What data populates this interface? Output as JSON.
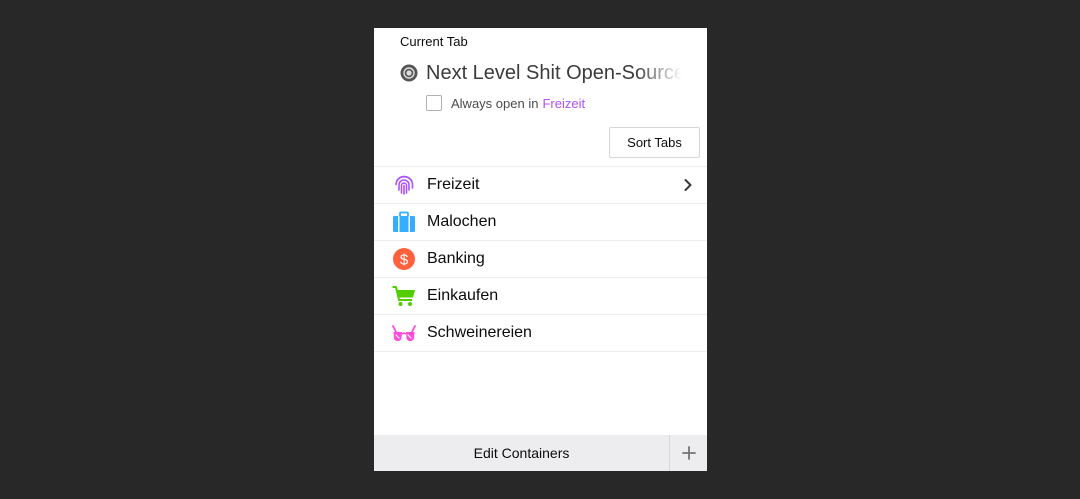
{
  "current_tab": {
    "section_label": "Current Tab",
    "title": "Next Level Shit Open-Source",
    "favicon": "record-icon",
    "always_open_prefix": "Always open in",
    "always_open_container": "Freizeit",
    "always_open_checked": false
  },
  "sort_tabs_label": "Sort Tabs",
  "containers": [
    {
      "name": "Freizeit",
      "icon": "fingerprint-icon",
      "color": "#af51f5",
      "has_submenu": true
    },
    {
      "name": "Malochen",
      "icon": "briefcase-icon",
      "color": "#37adff",
      "has_submenu": false
    },
    {
      "name": "Banking",
      "icon": "dollar-icon",
      "color": "#ff613d",
      "has_submenu": false
    },
    {
      "name": "Einkaufen",
      "icon": "cart-icon",
      "color": "#51cd00",
      "has_submenu": false
    },
    {
      "name": "Schweinereien",
      "icon": "glasses-icon",
      "color": "#ff4bda",
      "has_submenu": false
    }
  ],
  "footer": {
    "edit_label": "Edit Containers",
    "add_icon": "plus-icon"
  }
}
